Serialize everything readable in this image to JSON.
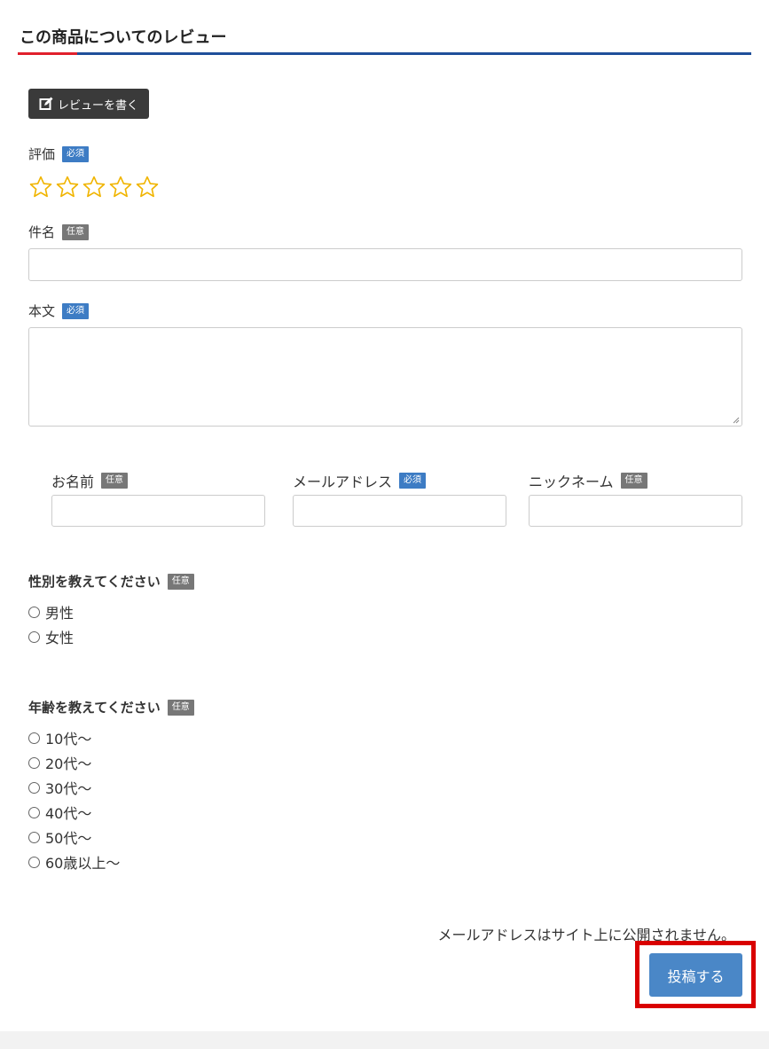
{
  "header": {
    "title": "この商品についてのレビュー"
  },
  "write_button": {
    "label": "レビューを書く",
    "icon": "edit-icon"
  },
  "rating": {
    "label": "評価",
    "badge": "必須",
    "stars_total": 5,
    "stars_selected": 0,
    "star_color": "#f0b400"
  },
  "subject": {
    "label": "件名",
    "badge": "任意",
    "value": ""
  },
  "body": {
    "label": "本文",
    "badge": "必須",
    "value": ""
  },
  "name": {
    "label": "お名前",
    "badge": "任意",
    "value": ""
  },
  "email": {
    "label": "メールアドレス",
    "badge": "必須",
    "value": ""
  },
  "nickname": {
    "label": "ニックネーム",
    "badge": "任意",
    "value": ""
  },
  "gender": {
    "label": "性別を教えてください",
    "badge": "任意",
    "options": [
      "男性",
      "女性"
    ]
  },
  "age": {
    "label": "年齢を教えてください",
    "badge": "任意",
    "options": [
      "10代～",
      "20代～",
      "30代～",
      "40代～",
      "50代～",
      "60歳以上～"
    ]
  },
  "notice": "メールアドレスはサイト上に公開されません。",
  "submit": {
    "label": "投稿する"
  },
  "colors": {
    "required_badge": "#3d7cc4",
    "optional_badge": "#777777",
    "submit": "#4a87c7",
    "highlight": "#d90000",
    "title_rule": "#1f4f9a",
    "title_accent": "#e0202c"
  }
}
